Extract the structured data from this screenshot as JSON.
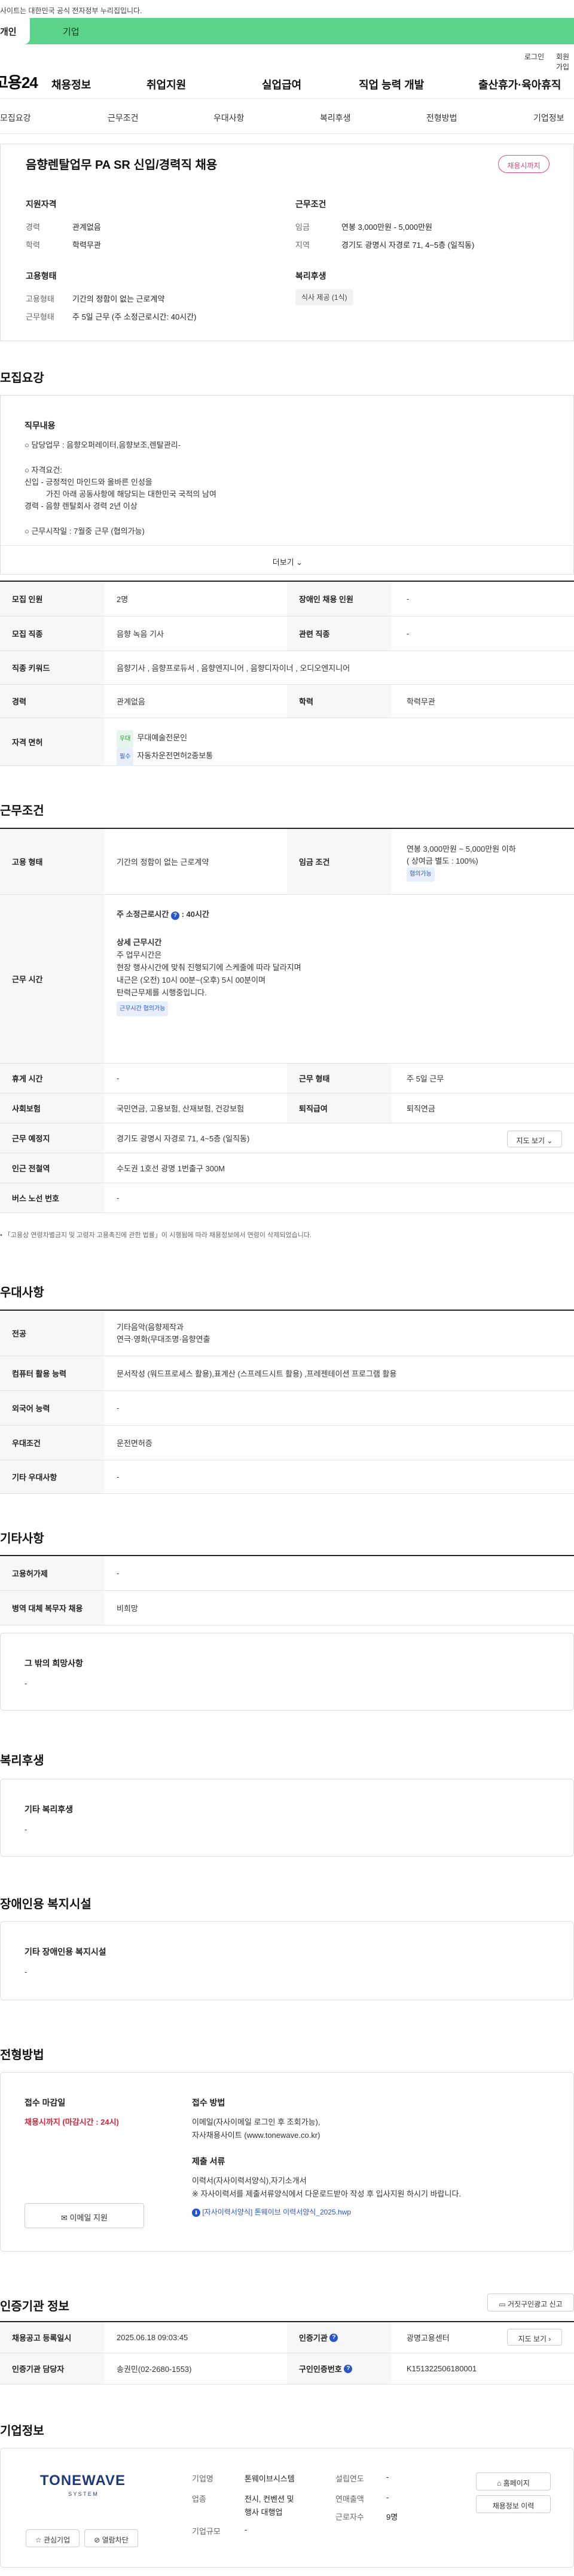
{
  "top_note": "사이트는 대한민국 공식 전자정부 누리집입니다.",
  "user_tabs": {
    "personal": "개인",
    "company": "기업"
  },
  "util": {
    "login": "로그인",
    "join": "회원가입"
  },
  "brand": {
    "logo": "고용24"
  },
  "gnb": [
    "채용정보",
    "취업지원",
    "실업급여",
    "직업 능력 개발",
    "출산휴가·육아휴직"
  ],
  "subnav": [
    "모집요강",
    "근무조건",
    "우대사항",
    "복리후생",
    "전형방법",
    "기업정보"
  ],
  "summary": {
    "title": "음향렌탈업무 PA SR 신입/경력직 채용",
    "badge": "채용시까지",
    "qual_h": "지원자격",
    "career_l": "경력",
    "career_v": "관계없음",
    "edu_l": "학력",
    "edu_v": "학력무관",
    "cond_h": "근무조건",
    "wage_l": "임금",
    "wage_v": "연봉 3,000만원 - 5,000만원",
    "region_l": "지역",
    "region_v": "경기도 광명시 자경로 71, 4~5층 (일직동)",
    "emp_h": "고용형태",
    "emptype_l": "고용형태",
    "emptype_v": "기간의 정함이 없는 근로계약",
    "worktype_l": "근무형태",
    "worktype_v": "주 5일 근무 (주 소정근로시간: 40시간)",
    "welfare_h": "복리후생",
    "welfare_chip": "식사 제공 (1식)"
  },
  "recruit": {
    "heading": "모집요강",
    "detail_h": "직무내용",
    "detail_lines": [
      "○ 담당업무 : 음향오퍼레이터,음향보조,렌탈관리-",
      "",
      "○ 자격요건:",
      "신입 - 긍정적인 마인드와 올바른 인성을",
      "          가진 아래 공동사항에 해당되는 대한민국 국적의 남여",
      "경력 - 음향 렌탈회사 경력 2년 이상",
      "",
      "○ 근무시작일 : 7월중 근무 (협의가능)"
    ],
    "more": "더보기",
    "rows": [
      {
        "th": "모집 인원",
        "td": "2명",
        "th2": "장애인 채용 인원",
        "td2": "-"
      },
      {
        "th": "모집 직종",
        "td": "음향 녹음 기사",
        "th2": "관련 직종",
        "td2": "-"
      },
      {
        "th": "직종 키워드",
        "td": "음향기사 , 음향프로듀서 , 음향엔지니어 , 음향디자이너 , 오디오엔지니어"
      },
      {
        "th": "경력",
        "td": "관계없음",
        "th2": "학력",
        "td2": "학력무관"
      }
    ],
    "license_th": "자격 면허",
    "license": [
      {
        "tag": "우대",
        "name": "무대예술전문인"
      },
      {
        "tag": "필수",
        "name": "자동차운전면허2종보통"
      }
    ]
  },
  "conditions": {
    "heading": "근무조건",
    "emp_th": "고용 형태",
    "emp_td": "기간의 정함이 없는 근로계약",
    "wage_th": "임금 조건",
    "wage_td": "연봉 3,000만원 ~ 5,000만원 이하",
    "wage_sub": "( 상여금 별도 : 100%)",
    "wage_tag": "협의가능",
    "hours_th": "근무 시간",
    "hours_main": "주 소정근로시간",
    "hours_main_v": "40시간",
    "hours_detail_h": "상세 근무시간",
    "hours_lines": [
      "주 업무시간은",
      "현장 행사시간에 맞춰 진행되기에 스케줄에 따라 달라지며",
      "내근은 (오전) 10시 00분~(오후) 5시 00분이며",
      "탄력근무제를 시행중입니다."
    ],
    "hours_tag": "근무시간 협의가능",
    "rest_th": "휴게 시간",
    "rest_td": "-",
    "form_th": "근무 형태",
    "form_td": "주 5일 근무",
    "ins_th": "사회보험",
    "ins_td": "국민연금, 고용보험, 산재보험, 건강보험",
    "sev_th": "퇴직급여",
    "sev_td": "퇴직연금",
    "place_th": "근무 예정지",
    "place_td": "경기도 광명시 자경로 71, 4~5층 (일직동)",
    "map_btn": "지도 보기",
    "subway_th": "인근 전철역",
    "subway_td": "수도권 1호선 광명 1번출구 300M",
    "bus_th": "버스 노선 번호",
    "bus_td": "-",
    "note": "「고용상 연령차별금지 및 고령자 고용촉진에 관한 법률」이 시행됨에 따라 채용정보에서 연령이 삭제되었습니다."
  },
  "preference": {
    "heading": "우대사항",
    "major_th": "전공",
    "major_lines": [
      "기타음악(음향제작과",
      "연극·영화(무대조명·음향연출"
    ],
    "pc_th": "컴퓨터 활용 능력",
    "pc_td": "문서작성 (워드프로세스 활용),표계산 (스프레드시트 활용) ,프레젠테이션 프로그램 활용",
    "lang_th": "외국어 능력",
    "lang_td": "-",
    "pref_th": "우대조건",
    "pref_td": "운전면허증",
    "etc_th": "기타 우대사항",
    "etc_td": "-"
  },
  "other": {
    "heading": "기타사항",
    "hire_th": "고용허가제",
    "hire_td": "-",
    "army_th": "병역 대체 복무자 채용",
    "army_td": "비희망",
    "wish_h": "그 밖의 희망사항",
    "wish_v": "-"
  },
  "welfare": {
    "heading": "복리후생",
    "h": "기타 복리후생",
    "v": "-"
  },
  "disabled": {
    "heading": "장애인용 복지시설",
    "h": "기타 장애인용 복지시설",
    "v": "-"
  },
  "selection": {
    "heading": "전형방법",
    "deadline_h": "접수 마감일",
    "deadline_v": "채용시까지 (마감시간 : 24시)",
    "method_h": "접수 방법",
    "method_lines": [
      "이메일(자사이메일 로그인 후 조회가능),",
      "자사채용사이트 (www.tonewave.co.kr)"
    ],
    "docs_h": "제출 서류",
    "docs_lines": [
      "이력서(자사이력서양식),자기소개서",
      "※ 자사이력서를 제출서류양식에서 다운로드받아 작성 후 입사지원 하시기 바랍니다."
    ],
    "file": "[자사이력서양식] 톤웨이브 이력서양식_2025.hwp",
    "email_btn": "이메일 지원"
  },
  "agency": {
    "heading": "인증기관 정보",
    "report_btn": "거짓구인광고 신고",
    "reg_th": "채용공고 등록일시",
    "reg_td": "2025.06.18 09:03:45",
    "agency_th": "인증기관",
    "agency_td": "광명고용센터",
    "map_btn": "지도 보기",
    "mgr_th": "인증기관 담당자",
    "mgr_td": "송권민(02-2680-1553)",
    "num_th": "구인인증번호",
    "num_td": "K151322506180001"
  },
  "company": {
    "heading": "기업정보",
    "logo_text": "TONEWAVE",
    "logo_sub": "S Y S T E M",
    "fav_btn": "관심기업",
    "block_btn": "열람차단",
    "name_l": "기업명",
    "name_v": "톤웨이브시스템",
    "ind_l": "업종",
    "ind_v": [
      "전시, 컨벤션 및",
      "행사 대행업"
    ],
    "size_l": "기업규모",
    "size_v": "-",
    "est_l": "설립연도",
    "est_v": "-",
    "rev_l": "연매출액",
    "rev_v": "-",
    "emp_l": "근로자수",
    "emp_v": "9명",
    "home_btn": "홈페이지",
    "jobs_btn": "채용정보 이력"
  },
  "colors": {
    "green": "#5cd38a",
    "accent_pink": "#e0487f",
    "deadline_red": "#d0263a",
    "link_blue": "#2a55c9"
  }
}
